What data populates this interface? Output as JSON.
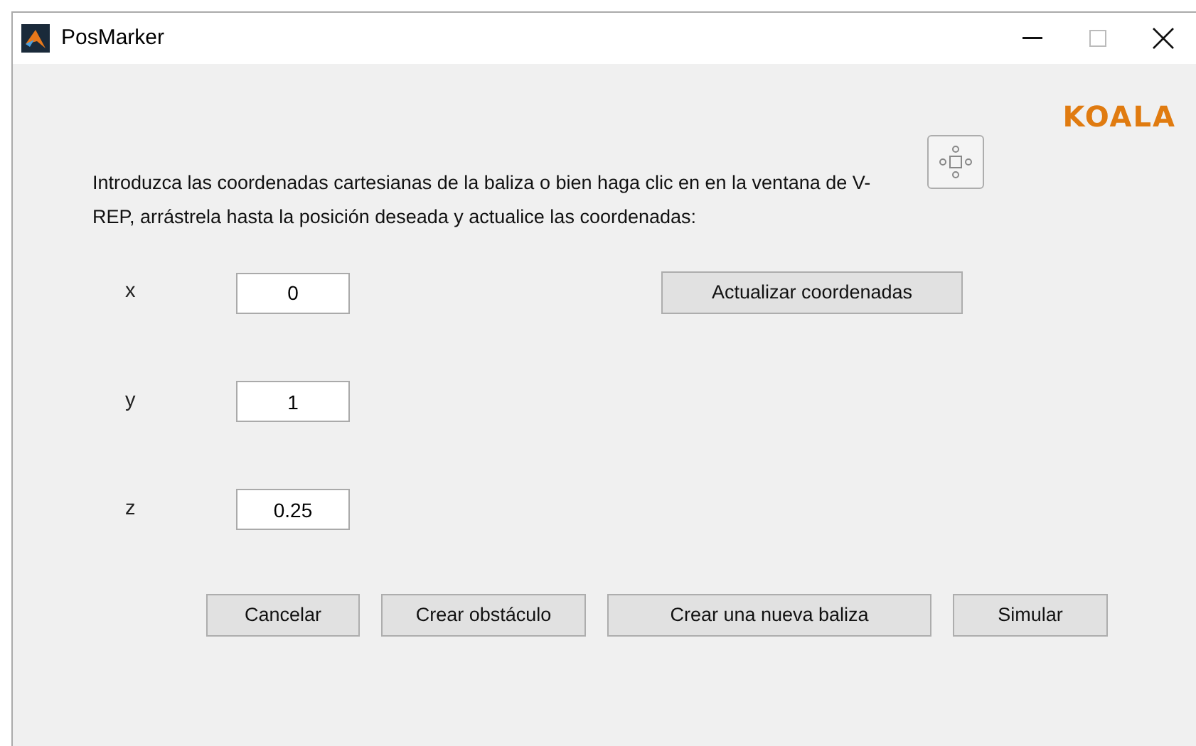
{
  "window": {
    "title": "PosMarker"
  },
  "logo": "KOALA",
  "instructions": "Introduzca las coordenadas cartesianas de la baliza o bien haga clic en en la ventana de V-REP, arrástrela hasta la posición deseada y actualice las coordenadas:",
  "fields": [
    {
      "label": "x",
      "value": "0"
    },
    {
      "label": "y",
      "value": "1"
    },
    {
      "label": "z",
      "value": "0.25"
    }
  ],
  "update_button": "Actualizar coordenadas",
  "buttons": [
    "Cancelar",
    "Crear obstáculo",
    "Crear una nueva baliza",
    "Simular"
  ]
}
